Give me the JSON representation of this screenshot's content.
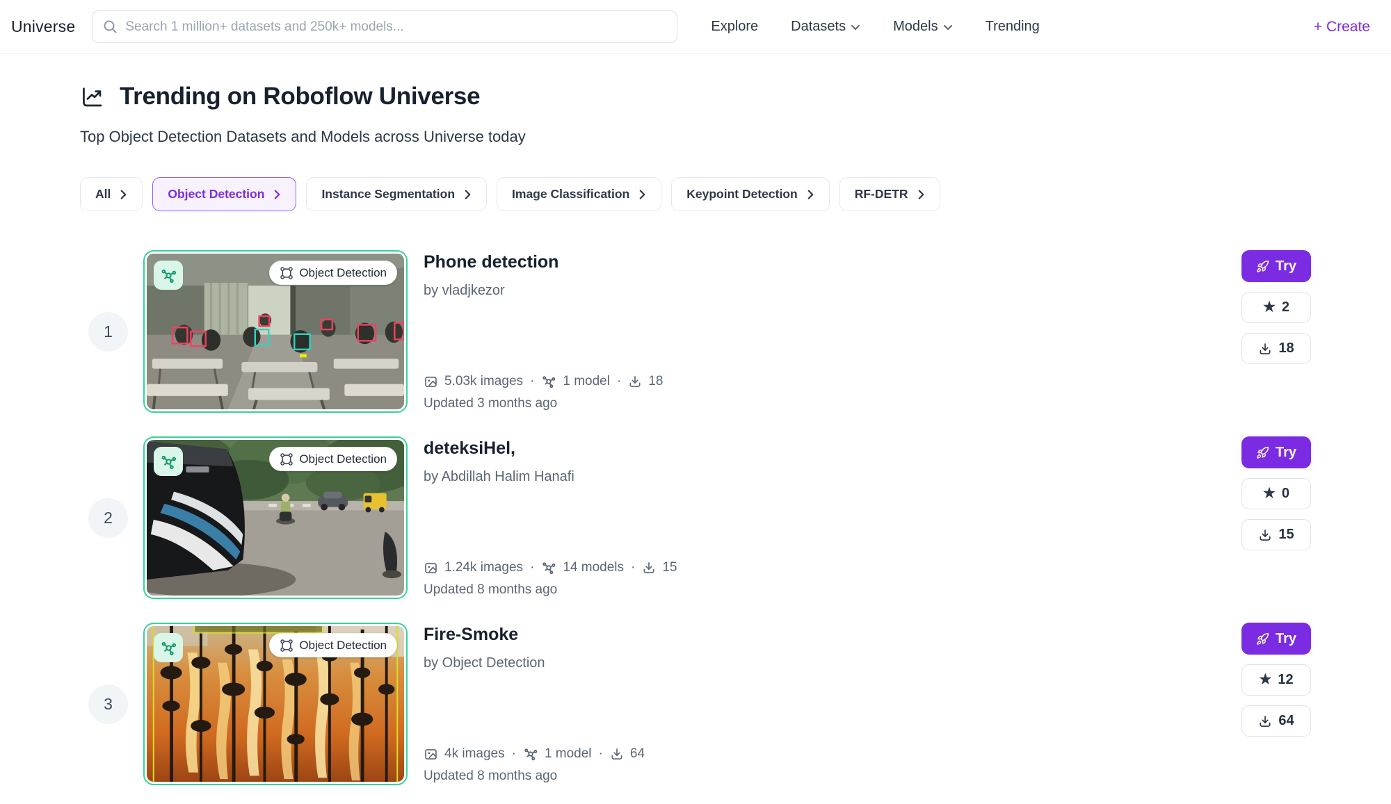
{
  "nav": {
    "brand": "Universe",
    "search_placeholder": "Search 1 million+ datasets and 250k+ models...",
    "links": [
      {
        "label": "Explore"
      },
      {
        "label": "Datasets"
      },
      {
        "label": "Models"
      },
      {
        "label": "Trending"
      }
    ],
    "create_label": "+ Create"
  },
  "header": {
    "title": "Trending on Roboflow Universe",
    "subtitle": "Top Object Detection Datasets and Models across Universe today"
  },
  "filters": [
    {
      "label": "All",
      "selected": false
    },
    {
      "label": "Object Detection",
      "selected": true
    },
    {
      "label": "Instance Segmentation",
      "selected": false
    },
    {
      "label": "Image Classification",
      "selected": false
    },
    {
      "label": "Keypoint Detection",
      "selected": false
    },
    {
      "label": "RF-DETR",
      "selected": false
    }
  ],
  "meta": {
    "separator": "·",
    "star_glyph": "★"
  },
  "cards": [
    {
      "rank": "1",
      "type_badge": "Object Detection",
      "title": "Phone detection",
      "author": "by vladjkezor",
      "images_label": "5.03k images",
      "models_label": "1 model",
      "downloads_inline": "18",
      "updated": "Updated 3 months ago",
      "try_label": "Try",
      "stars": "2",
      "downloads": "18"
    },
    {
      "rank": "2",
      "type_badge": "Object Detection",
      "title": "deteksiHel,",
      "author": "by Abdillah Halim Hanafi",
      "images_label": "1.24k images",
      "models_label": "14 models",
      "downloads_inline": "15",
      "updated": "Updated 8 months ago",
      "try_label": "Try",
      "stars": "0",
      "downloads": "15"
    },
    {
      "rank": "3",
      "type_badge": "Object Detection",
      "title": "Fire-Smoke",
      "author": "by Object Detection",
      "images_label": "4k images",
      "models_label": "1 model",
      "downloads_inline": "64",
      "updated": "Updated 8 months ago",
      "try_label": "Try",
      "stars": "12",
      "downloads": "64"
    }
  ],
  "colors": {
    "accent_purple": "#7b2ce2",
    "pill_selected_border": "#9061f2",
    "pill_selected_bg": "#f7f2fe",
    "thumb_border_green": "#37d39b",
    "badge_green_bg": "#d9f6e8",
    "badge_green_icon": "#149a6a",
    "muted_text": "#5b6675"
  }
}
